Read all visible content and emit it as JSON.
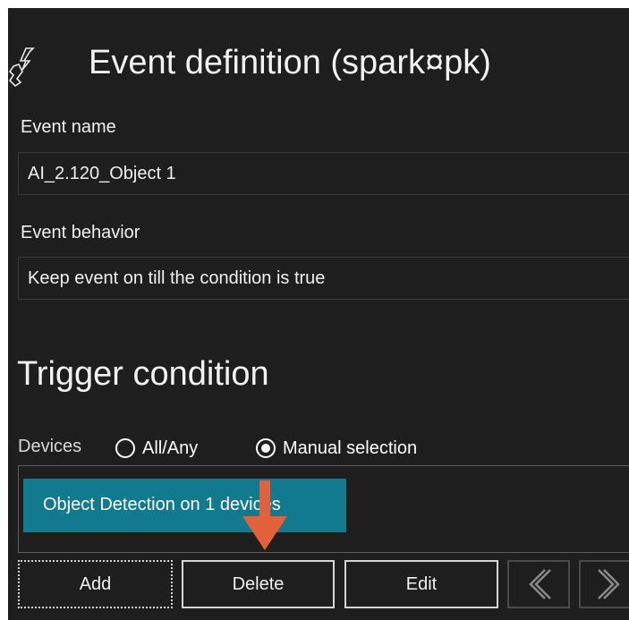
{
  "header": {
    "title": "Event definition (spark¤pk)"
  },
  "event_name": {
    "label": "Event name",
    "value": "AI_2.120_Object 1"
  },
  "event_behavior": {
    "label": "Event behavior",
    "value": "Keep event on till the condition is true"
  },
  "trigger": {
    "title": "Trigger condition",
    "devices_label": "Devices",
    "options": [
      {
        "label": "All/Any",
        "checked": false
      },
      {
        "label": "Manual selection",
        "checked": true
      }
    ],
    "items": [
      "Object Detection on 1 devices"
    ]
  },
  "buttons": {
    "add": "Add",
    "delete": "Delete",
    "edit": "Edit"
  },
  "colors": {
    "background": "#1e1e1e",
    "selected_item": "#127a8e",
    "annotation_arrow": "#e2603a"
  }
}
